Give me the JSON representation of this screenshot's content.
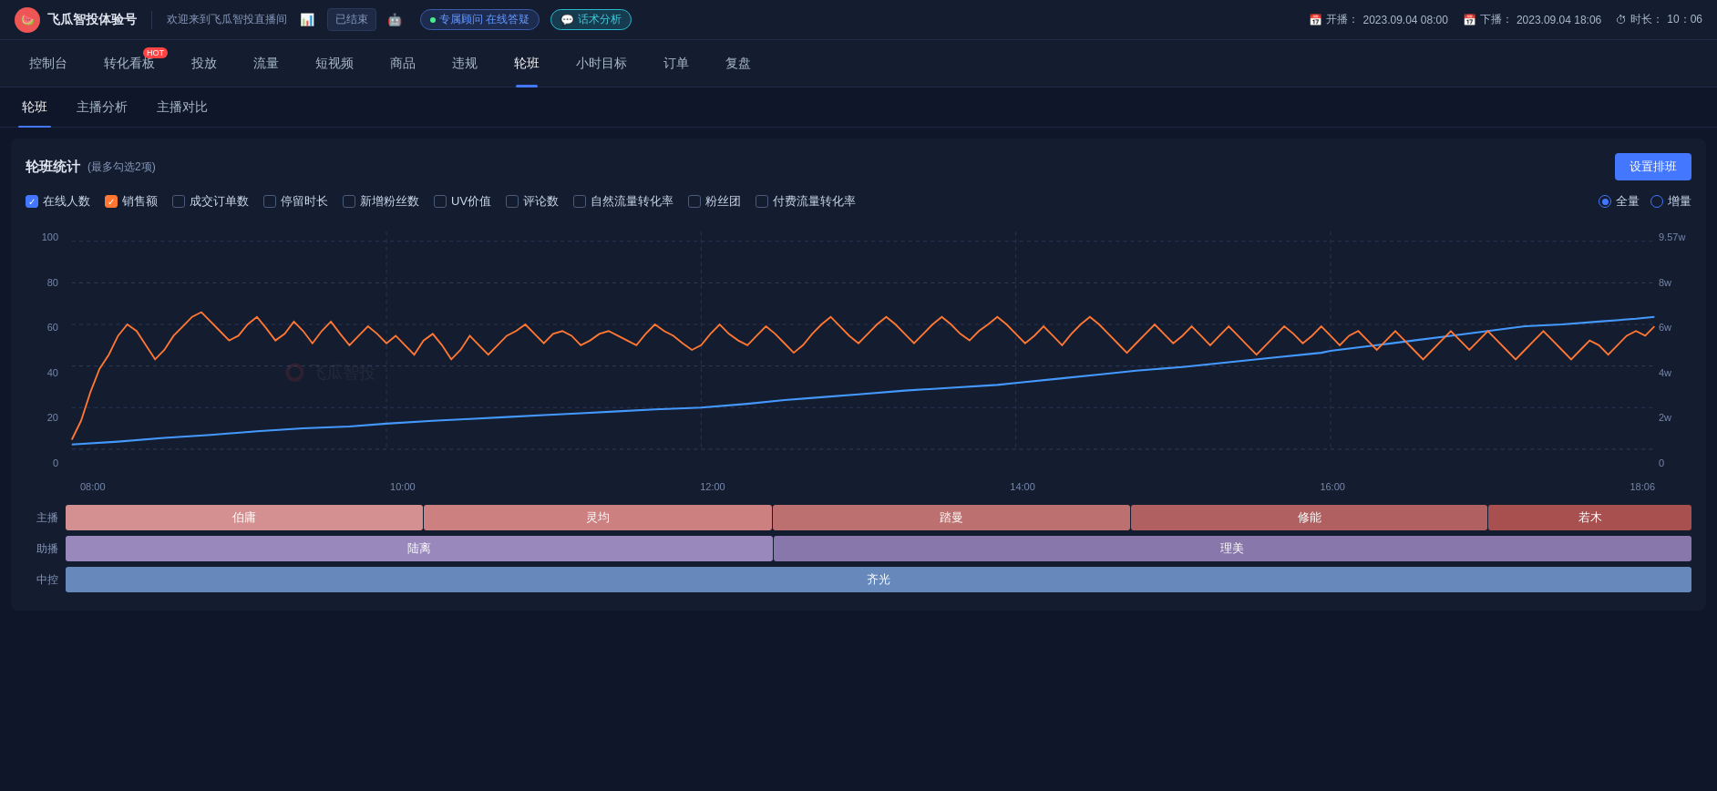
{
  "topbar": {
    "logo": "🍉",
    "app_name": "飞瓜智投体验号",
    "divider": "|",
    "welcome": "欢迎来到飞瓜智投直播间",
    "status_ended": "已结束",
    "badge_advisor": "专属顾问 在线答疑",
    "badge_strategy": "话术分析",
    "time_start_label": "开播：",
    "time_start": "2023.09.04 08:00",
    "time_end_label": "下播：",
    "time_end": "2023.09.04 18:06",
    "time_duration_label": "时长：",
    "time_duration": "10：06"
  },
  "mainnav": {
    "items": [
      {
        "label": "控制台",
        "active": false
      },
      {
        "label": "转化看板",
        "active": false,
        "hot": true
      },
      {
        "label": "投放",
        "active": false
      },
      {
        "label": "流量",
        "active": false
      },
      {
        "label": "短视频",
        "active": false
      },
      {
        "label": "商品",
        "active": false
      },
      {
        "label": "违规",
        "active": false
      },
      {
        "label": "轮班",
        "active": true
      },
      {
        "label": "小时目标",
        "active": false
      },
      {
        "label": "订单",
        "active": false
      },
      {
        "label": "复盘",
        "active": false
      }
    ]
  },
  "subnav": {
    "items": [
      {
        "label": "轮班",
        "active": true
      },
      {
        "label": "主播分析",
        "active": false
      },
      {
        "label": "主播对比",
        "active": false
      }
    ]
  },
  "stats": {
    "title": "轮班统计",
    "subtitle": "(最多勾选2项)",
    "setup_btn": "设置排班"
  },
  "checkboxes": [
    {
      "label": "在线人数",
      "checked": true,
      "color": "blue"
    },
    {
      "label": "销售额",
      "checked": true,
      "color": "orange"
    },
    {
      "label": "成交订单数",
      "checked": false,
      "color": "gray"
    },
    {
      "label": "停留时长",
      "checked": false,
      "color": "gray"
    },
    {
      "label": "新增粉丝数",
      "checked": false,
      "color": "gray"
    },
    {
      "label": "UV价值",
      "checked": false,
      "color": "gray"
    },
    {
      "label": "评论数",
      "checked": false,
      "color": "gray"
    },
    {
      "label": "自然流量转化率",
      "checked": false,
      "color": "gray"
    },
    {
      "label": "粉丝团",
      "checked": false,
      "color": "gray"
    },
    {
      "label": "付费流量转化率",
      "checked": false,
      "color": "gray"
    }
  ],
  "radio_group": [
    {
      "label": "全量",
      "selected": true
    },
    {
      "label": "增量",
      "selected": false
    }
  ],
  "chart": {
    "y_left": [
      "100",
      "80",
      "60",
      "40",
      "20",
      "0"
    ],
    "y_right": [
      "9.57w",
      "8w",
      "6w",
      "4w",
      "2w",
      "0"
    ],
    "x_labels": [
      "08:00",
      "10:00",
      "12:00",
      "14:00",
      "16:00",
      "18:06"
    ],
    "watermark": "飞瓜智投"
  },
  "schedule": {
    "rows": [
      {
        "label": "主播",
        "segments": [
          {
            "text": "伯庸",
            "width": 22,
            "color": "#e8a0a0"
          },
          {
            "text": "灵均",
            "width": 22,
            "color": "#e09090"
          },
          {
            "text": "踏曼",
            "width": 22,
            "color": "#d08080"
          },
          {
            "text": "修能",
            "width": 22,
            "color": "#c87070"
          },
          {
            "text": "若木",
            "width": 12,
            "color": "#c06060"
          }
        ]
      },
      {
        "label": "助播",
        "segments": [
          {
            "text": "陆离",
            "width": 44,
            "color": "#b0a0cc"
          },
          {
            "text": "理美",
            "width": 56,
            "color": "#9880bb"
          }
        ]
      },
      {
        "label": "中控",
        "segments": [
          {
            "text": "齐光",
            "width": 100,
            "color": "#7090cc"
          }
        ]
      }
    ]
  }
}
